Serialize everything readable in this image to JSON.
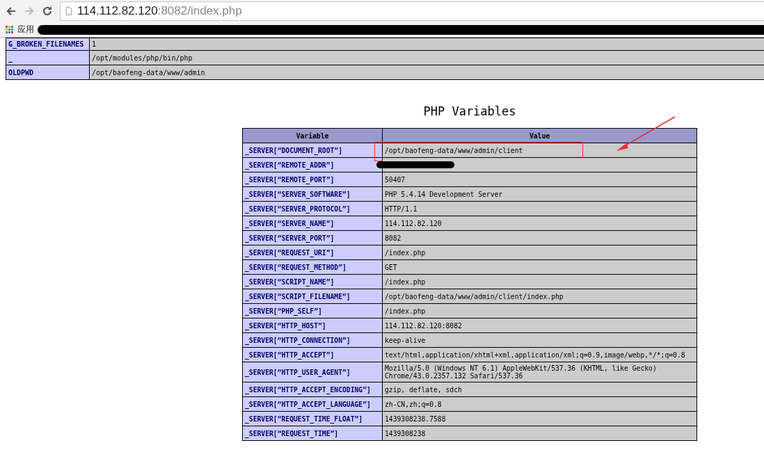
{
  "browser": {
    "url_host": "114.112.82.120",
    "url_rest": ":8082/index.php",
    "bookmarks": [
      {
        "label": "应用"
      }
    ],
    "bookmarks_redacted": true
  },
  "environment_table": {
    "rows": [
      {
        "name": "G_BROKEN_FILENAMES",
        "value": "1"
      },
      {
        "name": "_",
        "value": "/opt/modules/php/bin/php"
      },
      {
        "name": "OLDPWD",
        "value": "/opt/baofeng-data/www/admin"
      }
    ]
  },
  "php_variables": {
    "title": "PHP Variables",
    "columns": [
      "Variable",
      "Value"
    ],
    "rows": [
      {
        "name": "_SERVER[“DOCUMENT_ROOT”]",
        "value": "/opt/baofeng-data/www/admin/client",
        "highlighted": true,
        "redacted": false
      },
      {
        "name": "_SERVER[“REMOTE_ADDR”]",
        "value": "",
        "highlighted": false,
        "redacted": true
      },
      {
        "name": "_SERVER[“REMOTE_PORT”]",
        "value": "50407",
        "highlighted": false,
        "redacted": false
      },
      {
        "name": "_SERVER[“SERVER_SOFTWARE”]",
        "value": "PHP 5.4.14 Development Server",
        "highlighted": false,
        "redacted": false
      },
      {
        "name": "_SERVER[“SERVER_PROTOCOL”]",
        "value": "HTTP/1.1",
        "highlighted": false,
        "redacted": false
      },
      {
        "name": "_SERVER[“SERVER_NAME”]",
        "value": "114.112.82.120",
        "highlighted": false,
        "redacted": false
      },
      {
        "name": "_SERVER[“SERVER_PORT”]",
        "value": "8082",
        "highlighted": false,
        "redacted": false
      },
      {
        "name": "_SERVER[“REQUEST_URI”]",
        "value": "/index.php",
        "highlighted": false,
        "redacted": false
      },
      {
        "name": "_SERVER[“REQUEST_METHOD”]",
        "value": "GET",
        "highlighted": false,
        "redacted": false
      },
      {
        "name": "_SERVER[“SCRIPT_NAME”]",
        "value": "/index.php",
        "highlighted": false,
        "redacted": false
      },
      {
        "name": "_SERVER[“SCRIPT_FILENAME”]",
        "value": "/opt/baofeng-data/www/admin/client/index.php",
        "highlighted": false,
        "redacted": false
      },
      {
        "name": "_SERVER[“PHP_SELF”]",
        "value": "/index.php",
        "highlighted": false,
        "redacted": false
      },
      {
        "name": "_SERVER[“HTTP_HOST”]",
        "value": "114.112.82.120:8082",
        "highlighted": false,
        "redacted": false
      },
      {
        "name": "_SERVER[“HTTP_CONNECTION”]",
        "value": "keep-alive",
        "highlighted": false,
        "redacted": false
      },
      {
        "name": "_SERVER[“HTTP_ACCEPT”]",
        "value": "text/html,application/xhtml+xml,application/xml;q=0.9,image/webp,*/*;q=0.8",
        "highlighted": false,
        "redacted": false
      },
      {
        "name": "_SERVER[“HTTP_USER_AGENT”]",
        "value": "Mozilla/5.0 (Windows NT 6.1) AppleWebKit/537.36 (KHTML, like Gecko) Chrome/43.0.2357.132 Safari/537.36",
        "highlighted": false,
        "redacted": false
      },
      {
        "name": "_SERVER[“HTTP_ACCEPT_ENCODING”]",
        "value": "gzip, deflate, sdch",
        "highlighted": false,
        "redacted": false
      },
      {
        "name": "_SERVER[“HTTP_ACCEPT_LANGUAGE”]",
        "value": "zh-CN,zh;q=0.8",
        "highlighted": false,
        "redacted": false
      },
      {
        "name": "_SERVER[“REQUEST_TIME_FLOAT”]",
        "value": "1439308238.7588",
        "highlighted": false,
        "redacted": false
      },
      {
        "name": "_SERVER[“REQUEST_TIME”]",
        "value": "1439308238",
        "highlighted": false,
        "redacted": false
      }
    ]
  }
}
